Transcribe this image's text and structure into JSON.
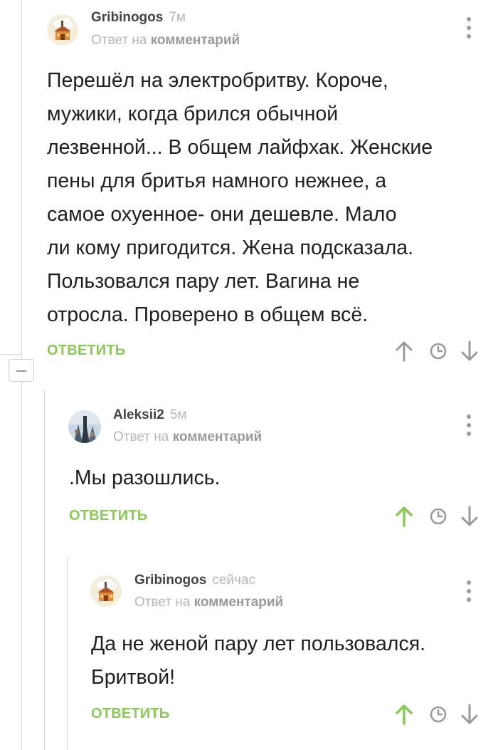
{
  "colors": {
    "accent_green": "#8ac858",
    "muted_gray": "#9a9a9a",
    "text": "#1f1f1f"
  },
  "comments": [
    {
      "author": "Gribinogos",
      "time": "7м",
      "reply_prefix": "Ответ на",
      "reply_target": "комментарий",
      "lines": [
        "Перешёл на электробритву. Короче,",
        "мужики, когда брился обычной",
        "лезвенной... В общем лайфхак. Женские",
        "пены для бритья намного нежнее, а",
        "самое охуенное- они дешевле. Мало",
        "ли кому пригодится. Жена подсказала.",
        "Пользовался пару лет. Вагина не",
        "отросла. Проверено в общем всё."
      ],
      "reply_label": "ОТВЕТИТЬ",
      "upvoted": false,
      "avatar_icon": "house-avatar-icon"
    },
    {
      "author": "Aleksii2",
      "time": "5м",
      "reply_prefix": "Ответ на",
      "reply_target": "комментарий",
      "lines": [
        ".Мы разошлись."
      ],
      "reply_label": "ОТВЕТИТЬ",
      "upvoted": true,
      "avatar_icon": "photo-avatar-icon"
    },
    {
      "author": "Gribinogos",
      "time": "сейчас",
      "reply_prefix": "Ответ на",
      "reply_target": "комментарий",
      "lines": [
        "Да не женой пару лет пользовался.",
        "Бритвой!"
      ],
      "reply_label": "ОТВЕТИТЬ",
      "upvoted": true,
      "avatar_icon": "house-avatar-icon"
    }
  ]
}
